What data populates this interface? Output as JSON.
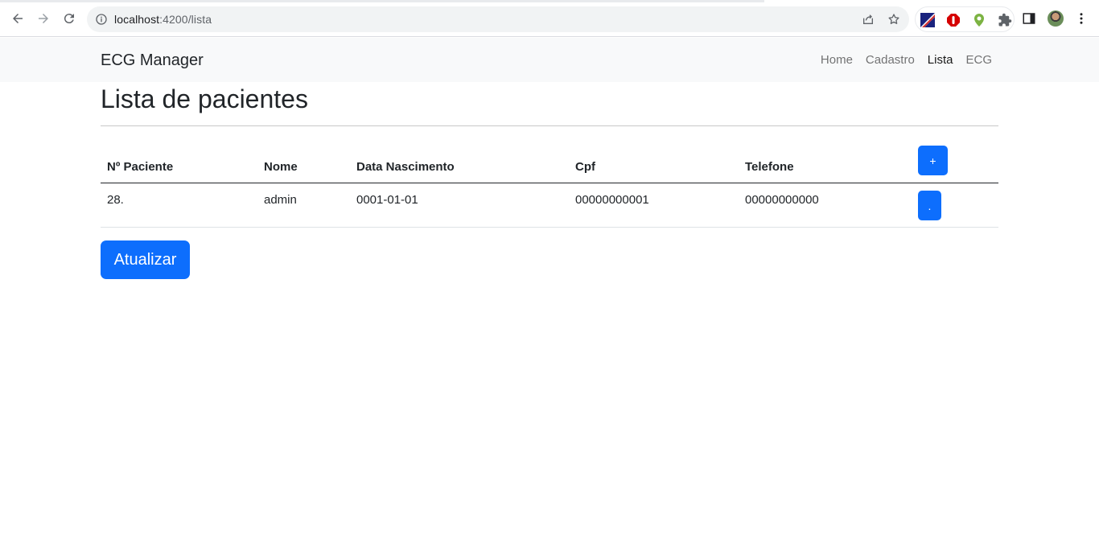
{
  "browser": {
    "url_host": "localhost",
    "url_path": ":4200/lista"
  },
  "navbar": {
    "brand": "ECG Manager",
    "links": [
      {
        "label": "Home",
        "active": false
      },
      {
        "label": "Cadastro",
        "active": false
      },
      {
        "label": "Lista",
        "active": true
      },
      {
        "label": "ECG",
        "active": false
      }
    ]
  },
  "page": {
    "title": "Lista de pacientes"
  },
  "table": {
    "columns": [
      "Nº Paciente",
      "Nome",
      "Data Nascimento",
      "Cpf",
      "Telefone"
    ],
    "add_button_label": "+",
    "rows": [
      {
        "numero": "28.",
        "nome": "admin",
        "data_nascimento": "0001-01-01",
        "cpf": "00000000001",
        "telefone": "00000000000",
        "action_label": "."
      }
    ]
  },
  "actions": {
    "refresh_label": "Atualizar"
  },
  "colors": {
    "primary": "#0d6efd",
    "navbar_bg": "#f8f9fa"
  },
  "icons": [
    "back-arrow-icon",
    "forward-arrow-icon",
    "reload-icon",
    "info-icon",
    "share-icon",
    "star-icon",
    "extension-puzzle-icon",
    "side-panel-icon",
    "kebab-menu-icon"
  ]
}
